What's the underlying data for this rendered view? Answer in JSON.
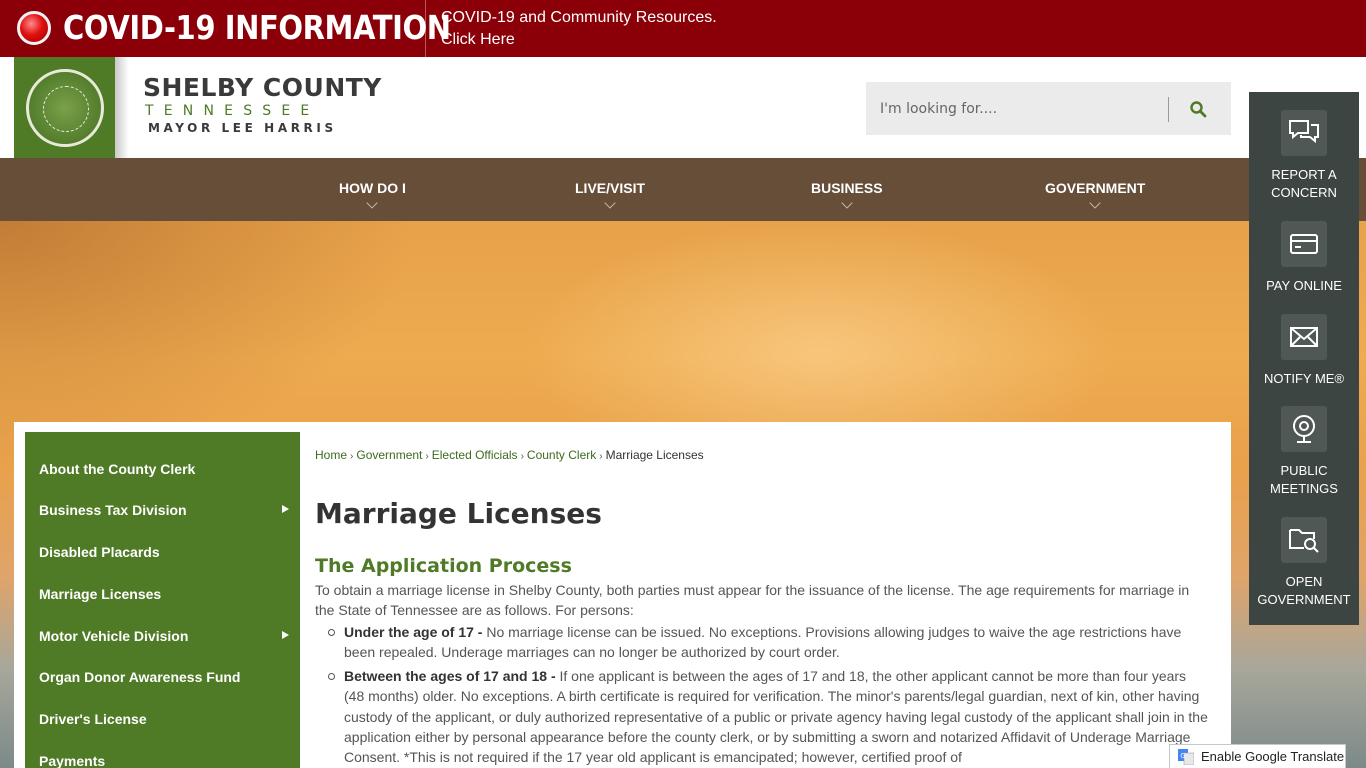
{
  "covid": {
    "title": "COVID-19 INFORMATION",
    "link_line1": "COVID-19 and Community Resources.",
    "link_line2": "Click Here"
  },
  "logo": {
    "name": "SHELBY COUNTY",
    "state": "TENNESSEE",
    "mayor": "MAYOR LEE HARRIS"
  },
  "search": {
    "placeholder": "I'm looking for...."
  },
  "nav": {
    "items": [
      {
        "label": "HOW DO I"
      },
      {
        "label": "LIVE/VISIT"
      },
      {
        "label": "BUSINESS"
      },
      {
        "label": "GOVERNMENT"
      }
    ]
  },
  "rail": {
    "items": [
      {
        "line1": "REPORT A",
        "line2": "CONCERN",
        "icon": "chat-bubbles-icon"
      },
      {
        "line1": "PAY ONLINE",
        "line2": "",
        "icon": "credit-card-icon"
      },
      {
        "line1": "NOTIFY ME®",
        "line2": "",
        "icon": "envelope-icon"
      },
      {
        "line1": "PUBLIC",
        "line2": "MEETINGS",
        "icon": "webcam-icon"
      },
      {
        "line1": "OPEN",
        "line2": "GOVERNMENT",
        "icon": "folder-search-icon"
      }
    ]
  },
  "sidebar": {
    "items": [
      {
        "label": "About the County Clerk",
        "has_submenu": false
      },
      {
        "label": "Business Tax Division",
        "has_submenu": true
      },
      {
        "label": "Disabled Placards",
        "has_submenu": false
      },
      {
        "label": "Marriage Licenses",
        "has_submenu": false
      },
      {
        "label": "Motor Vehicle Division",
        "has_submenu": true
      },
      {
        "label": "Organ Donor Awareness Fund",
        "has_submenu": false
      },
      {
        "label": "Driver's License",
        "has_submenu": false
      },
      {
        "label": "Payments",
        "has_submenu": false
      }
    ]
  },
  "breadcrumb": {
    "items": [
      "Home",
      "Government",
      "Elected Officials",
      "County Clerk"
    ],
    "current": "Marriage Licenses"
  },
  "content": {
    "title": "Marriage Licenses",
    "section_title": "The Application Process",
    "intro": "To obtain a marriage license in Shelby County, both parties must appear for the issuance of the license. The age requirements for marriage in the State of Tennessee are as follows. For persons:",
    "bullets": [
      {
        "lead": "Under the age of 17 -",
        "text": " No marriage license can be issued. No exceptions. Provisions allowing judges to waive the age restrictions have been repealed. Underage marriages can no longer be authorized by court order."
      },
      {
        "lead": "Between the ages of 17 and 18 -",
        "text": " If one applicant is between the ages of 17 and 18, the other applicant cannot be more than four years (48 months) older. No exceptions. A birth certificate is required for verification. The minor's parents/legal guardian, next of kin, other having custody of the applicant, or duly authorized representative of a public or private agency having legal custody of the applicant shall join in the application either by personal appearance before the county clerk, or by submitting a sworn and notarized Affidavit of Underage Marriage Consent. *This is not required if the 17 year old applicant is emancipated; however, certified proof of"
      }
    ]
  },
  "translate": {
    "label": "Enable Google Translate"
  },
  "colors": {
    "covid_red": "#8b0008",
    "brand_green": "#4f7a26",
    "nav_brown": "#564234",
    "rail_gray": "#3d4542"
  }
}
